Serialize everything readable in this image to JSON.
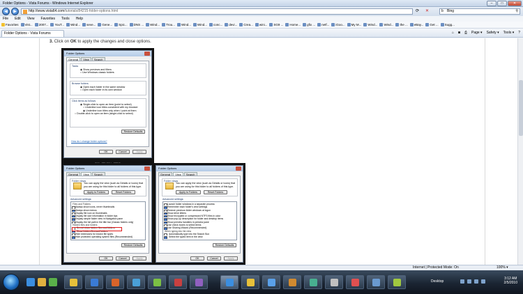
{
  "window": {
    "title": "Folder Options - Vista Forums - Windows Internet Explorer"
  },
  "address": {
    "url_domain": "http://www.vista64.com",
    "url_path": "/tutorials/84215-folder-options.html",
    "search_value": "Bing"
  },
  "menu": [
    "File",
    "Edit",
    "View",
    "Favorites",
    "Tools",
    "Help"
  ],
  "links": [
    "Favorites",
    "Vist...",
    "2007...",
    "YouT...",
    "Wind...",
    "seve...",
    "Gene...",
    "Spic...",
    "DNS ...",
    "Wind...",
    "Trou...",
    "Wind...",
    "Wind...",
    "conc...",
    "devi...",
    "Crea...",
    "wini...",
    "SG9 ...",
    "Home...",
    "gfix ...",
    "netf...",
    "iGoo...",
    "My M...",
    "Wind...",
    "Wind...",
    "the ...",
    "eBay...",
    "Get ...",
    "Sugg..."
  ],
  "tab": {
    "title": "Folder Options - Vista Forums"
  },
  "commands": [
    "Page ▾",
    "Safety ▾",
    "Tools ▾",
    "?"
  ],
  "article": {
    "step_num": "3.",
    "step_pre": "Click on",
    "step_bold": "OK",
    "step_post": "to apply the changes and close options."
  },
  "dialog1": {
    "title": "Folder Options",
    "tabs": [
      "General",
      "View",
      "Search"
    ],
    "tasks_label": "Tasks",
    "tasks_opts": [
      "Show previews and filters",
      "Use Windows classic folders"
    ],
    "browse_label": "Browse folders",
    "browse_opts": [
      "Open each folder in the same window",
      "Open each folder in its own window"
    ],
    "click_label": "Click items as follows",
    "click_opts": [
      "Single-click to open an item (point to select)",
      "Underline icon titles consistent with my browser",
      "Underline icon titles only when I point at them",
      "Double-click to open an item (single-click to select)"
    ],
    "restore": "Restore Defaults",
    "link": "How do I change folder options?",
    "ok": "OK",
    "cancel": "Cancel",
    "apply": "Apply",
    "caption": "296x475  39kb  JPEG"
  },
  "dialog2": {
    "title": "Folder Options",
    "tabs": [
      "General",
      "View",
      "Search"
    ],
    "fv_label": "Folder views",
    "fv_desc": "You can apply the view (such as Details or Icons) that you are using for this folder to all folders of this type.",
    "apply_folders": "Apply to Folders",
    "reset_folders": "Reset Folders",
    "adv_label": "Advanced settings:",
    "adv_items": [
      "Files and Folders",
      "Always show icons, never thumbnails",
      "Always show menus",
      "Display file icon on thumbnails",
      "Display file size information in folder tips",
      "Display simple folder view in Navigation pane",
      "Display the full path in the title bar (Classic folders only)",
      "Hidden files and folders",
      "Do not show hidden files and folders",
      "Show hidden files and folders",
      "Hide extensions for known file types",
      "Hide protected operating system files (Recommended)"
    ],
    "restore": "Restore Defaults",
    "ok": "OK",
    "cancel": "Cancel",
    "apply": "Apply"
  },
  "dialog3": {
    "title": "Folder Options",
    "tabs": [
      "General",
      "View",
      "Search"
    ],
    "fv_label": "Folder views",
    "fv_desc": "You can apply the view (such as Details or Icons) that you are using for this folder to all folders of this type.",
    "apply_folders": "Apply to Folders",
    "reset_folders": "Reset Folders",
    "adv_label": "Advanced settings:",
    "adv_items": [
      "Launch folder windows in a separate process",
      "Remember each folder's view settings",
      "Restore previous folder windows at logon",
      "Show drive letters",
      "Show encrypted or compressed NTFS files in color",
      "Show pop-up description for folder and desktop items",
      "Show preview handlers in preview pane",
      "Use check boxes to select items",
      "Use Sharing Wizard (Recommended)",
      "When typing into list view",
      "Automatically type into the Search Box",
      "Select the typed item in the view"
    ],
    "restore": "Restore Defaults",
    "ok": "OK",
    "cancel": "Cancel",
    "apply": "Apply"
  },
  "status": {
    "zone": "Internet | Protected Mode: On",
    "zoom": "100% ▾"
  },
  "tray": {
    "desktop": "Desktop",
    "time": "3:12 AM",
    "date": "2/5/2010"
  },
  "colors": {
    "highlight": "#e01b1b",
    "taskbar": "#1b2533"
  }
}
